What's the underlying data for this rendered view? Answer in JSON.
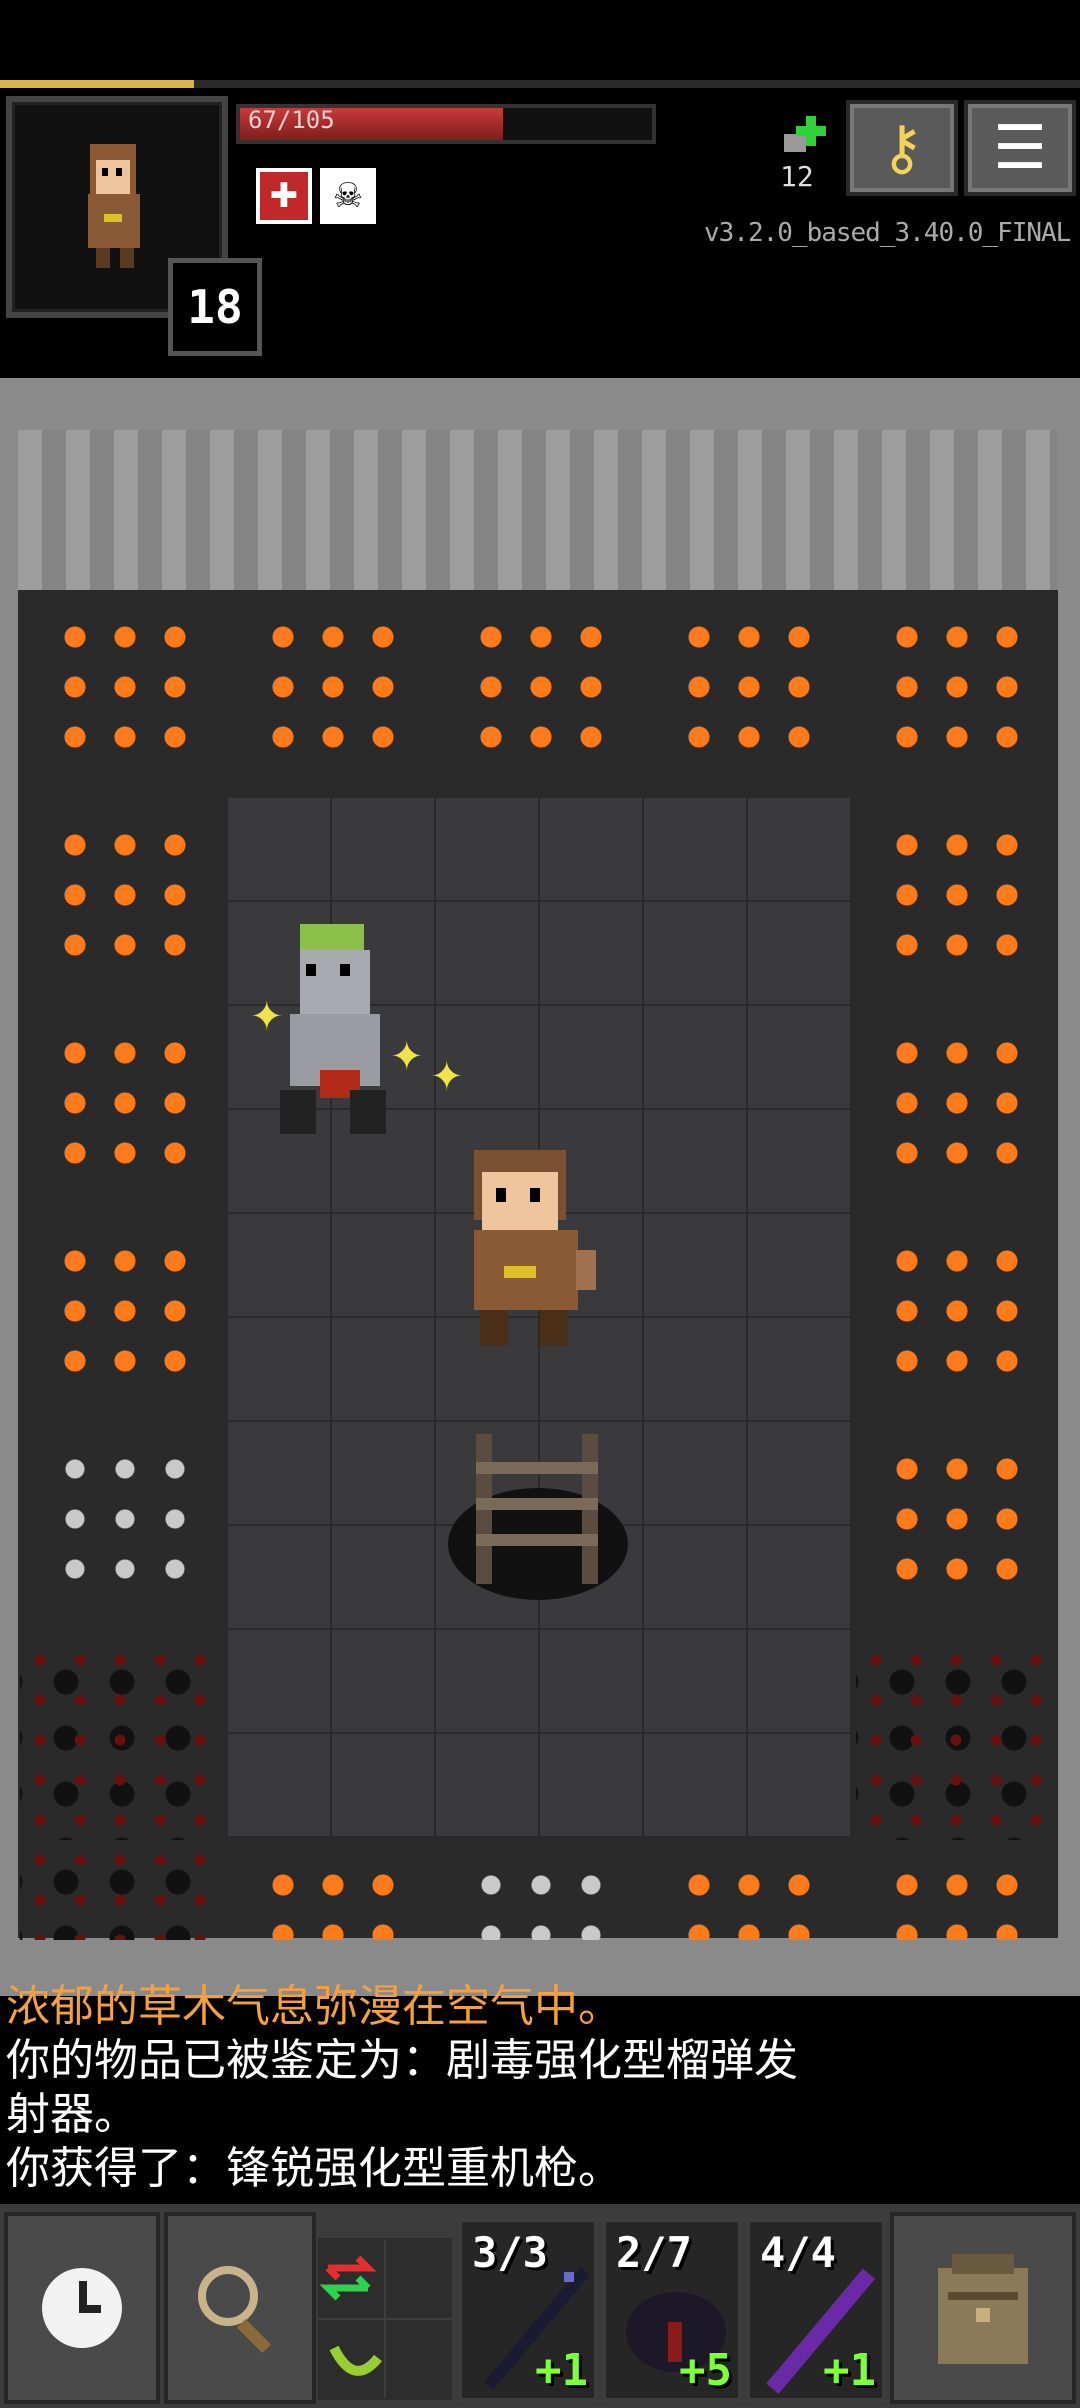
{
  "status": {
    "xp_fraction": 0.18,
    "hp_text": "67/105",
    "hp_fraction": 0.638,
    "depth": "18",
    "challenges": "12",
    "version": "v3.2.0_based_3.40.0_FINAL"
  },
  "buffs": [
    {
      "icon": "regeneration-icon"
    },
    {
      "icon": "skull-icon"
    }
  ],
  "buttons": {
    "journal_icon": "key-icon",
    "menu_icon": "menu-icon"
  },
  "log": {
    "lines": [
      "浓郁的草木气息弥漫在空气中。",
      "你的物品已被鉴定为：剧毒强化型榴弹发\n射器。",
      "你获得了：锋锐强化型重机枪。"
    ]
  },
  "quickslots": [
    {
      "count": "3/3",
      "bonus": "+1",
      "icon": "staff-icon"
    },
    {
      "count": "2/7",
      "bonus": "+5",
      "icon": "dark-staff-icon"
    },
    {
      "count": "4/4",
      "bonus": "+1",
      "icon": "purple-staff-icon"
    }
  ],
  "toolbar": {
    "wait_icon": "clock-icon",
    "search_icon": "magnifier-icon",
    "swap_icon": "swap-icon",
    "backpack_icon": "backpack-icon"
  }
}
